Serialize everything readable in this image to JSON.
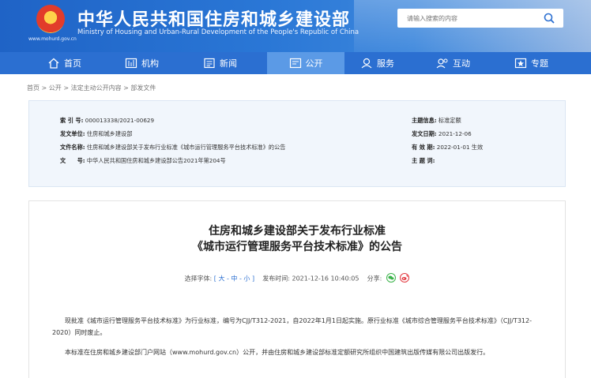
{
  "header": {
    "title": "中华人民共和国住房和城乡建设部",
    "subtitle": "Ministry of Housing and Urban-Rural Development of the People's Republic of China",
    "url": "www.mohurd.gov.cn",
    "search_placeholder": "请输入搜索的内容"
  },
  "nav": [
    {
      "label": "首页",
      "icon": "home-icon"
    },
    {
      "label": "机构",
      "icon": "organization-icon"
    },
    {
      "label": "新闻",
      "icon": "news-icon"
    },
    {
      "label": "公开",
      "icon": "disclosure-icon"
    },
    {
      "label": "服务",
      "icon": "service-icon"
    },
    {
      "label": "互动",
      "icon": "interaction-icon"
    },
    {
      "label": "专题",
      "icon": "topic-icon"
    }
  ],
  "active_nav": "公开",
  "breadcrumb": "首页 > 公开 > 法定主动公开内容 > 部发文件",
  "info": {
    "index_label": "索 引 号:",
    "index_value": "000013338/2021-00629",
    "unit_label": "发文单位:",
    "unit_value": "住房和城乡建设部",
    "name_label": "文件名称:",
    "name_value": "住房和城乡建设部关于发布行业标准《城市运行管理服务平台技术标准》的公告",
    "doc_label": "文　　号:",
    "doc_value": "中华人民共和国住房和城乡建设部公告2021年第204号",
    "category_label": "主题信息:",
    "category_value": "标准定额",
    "date_label": "发文日期:",
    "date_value": "2021-12-06",
    "valid_label": "有 效 期:",
    "valid_value": "2022-01-01 生效",
    "topic_label": "主 题 词:",
    "topic_value": ""
  },
  "article": {
    "title_line1": "住房和城乡建设部关于发布行业标准",
    "title_line2": "《城市运行管理服务平台技术标准》的公告",
    "font_size_label": "选择字体:",
    "font_size_options": "[ 大 - 中 - 小 ]",
    "publish_label": "发布时间:",
    "publish_time": "2021-12-16 10:40:05",
    "share_label": "分享:",
    "paragraph1": "现批准《城市运行管理服务平台技术标准》为行业标准，编号为CJJ/T312-2021，自2022年1月1日起实施。原行业标准《城市综合管理服务平台技术标准》（CJJ/T312-2020）同时废止。",
    "paragraph2": "本标准在住房和城乡建设部门户网站（www.mohurd.gov.cn）公开，并由住房和城乡建设部标准定额研究所组织中国建筑出版传媒有限公司出版发行。"
  },
  "colors": {
    "header_blue": "#1f63c6",
    "nav_blue": "#2b6fd1",
    "nav_active": "#5b9ae6",
    "info_bg": "#f1f6fc"
  }
}
